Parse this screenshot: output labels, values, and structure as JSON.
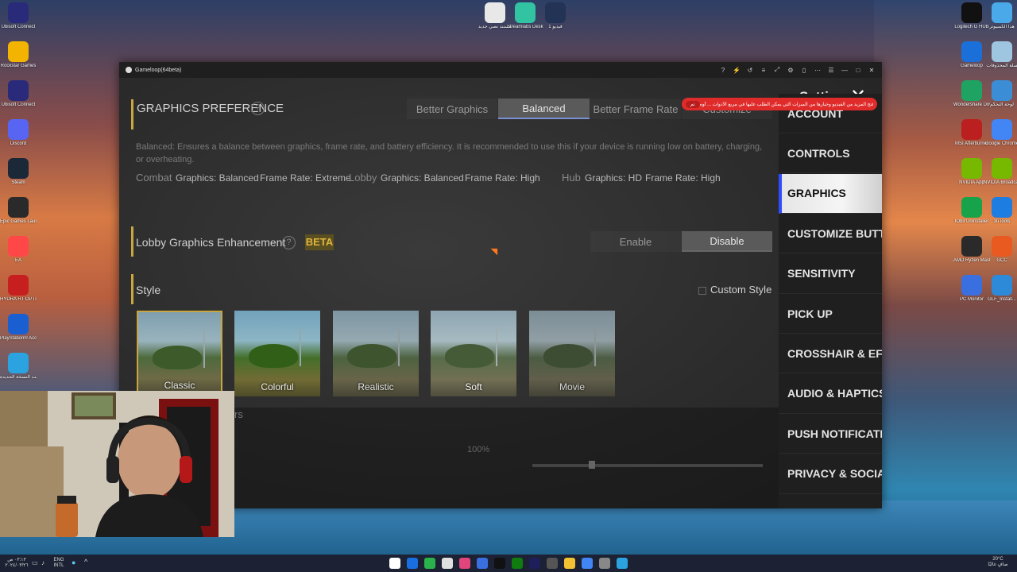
{
  "desktop": {
    "left_icons": [
      {
        "label": "Ubisoft Connect",
        "icon": "ubisoft-icon",
        "color": "#2a2a7a"
      },
      {
        "label": "Rockstar Games",
        "icon": "rockstar-icon",
        "color": "#f2b400"
      },
      {
        "label": "Ubisoft Connect",
        "icon": "ubisoft-icon",
        "color": "#2a2a7a"
      },
      {
        "label": "Discord",
        "icon": "discord-icon",
        "color": "#5865f2"
      },
      {
        "label": "Steam",
        "icon": "steam-icon",
        "color": "#1b2838"
      },
      {
        "label": "Epic Games Launcher",
        "icon": "epic-icon",
        "color": "#2a2a2a"
      },
      {
        "label": "EA",
        "icon": "ea-icon",
        "color": "#ff4747"
      },
      {
        "label": "HYDRA RT OPTICAL",
        "icon": "hydra-icon",
        "color": "#c71f1f"
      },
      {
        "label": "PlayStation® Accessories",
        "icon": "playstation-icon",
        "color": "#1a5fd1"
      },
      {
        "label": "تحديث النسخة الجديدة",
        "icon": "update-icon",
        "color": "#2aa3e0"
      }
    ],
    "top_icons": [
      {
        "label": "مستند نصي جديد",
        "icon": "document-icon",
        "color": "#e8e8e8"
      },
      {
        "label": "Streamlabs Desktop",
        "icon": "streamlabs-icon",
        "color": "#31c3a2"
      },
      {
        "label": "فيديو 1",
        "icon": "video-icon",
        "color": "#223355"
      }
    ],
    "right_icons": [
      {
        "label": "Logitech G HUB",
        "icon": "logitech-icon",
        "color": "#111111"
      },
      {
        "label": "هذا الكمبيوتر",
        "icon": "computer-icon",
        "color": "#4aa9e8"
      },
      {
        "label": "Gameloop",
        "icon": "gameloop-icon",
        "color": "#1b6fd9"
      },
      {
        "label": "سلة المحذوفات",
        "icon": "recycle-bin-icon",
        "color": "#9fc6e0"
      },
      {
        "label": "Wondershare Downloader",
        "icon": "wondershare-icon",
        "color": "#1ea363"
      },
      {
        "label": "لوحة التحكم",
        "icon": "control-panel-icon",
        "color": "#3b8ed6"
      },
      {
        "label": "MSI Afterburner",
        "icon": "afterburner-icon",
        "color": "#bb1f1f"
      },
      {
        "label": "Google Chrome",
        "icon": "chrome-icon",
        "color": "#4285f4"
      },
      {
        "label": "NVIDIA App",
        "icon": "nvidia-icon",
        "color": "#76b900"
      },
      {
        "label": "NVIDIA Broadcast",
        "icon": "nvidia-broadcast-icon",
        "color": "#76b900"
      },
      {
        "label": "IObit Uninstaller",
        "icon": "iobit-icon",
        "color": "#17a34a"
      },
      {
        "label": "3uTools",
        "icon": "3utools-icon",
        "color": "#1e7de0"
      },
      {
        "label": "AMD Ryzen Master",
        "icon": "ryzen-icon",
        "color": "#2a2a2a"
      },
      {
        "label": "GCC",
        "icon": "gcc-icon",
        "color": "#e85a1f"
      },
      {
        "label": "PC Monitor",
        "icon": "pc-monitor-icon",
        "color": "#3a6fe0"
      },
      {
        "label": "GLF_Install...",
        "icon": "installer-icon",
        "color": "#2c8ad9"
      }
    ]
  },
  "window": {
    "title": "Gameloop(64beta)",
    "controls": [
      "?",
      "⚡",
      "↺",
      "≡",
      "⤢",
      "⚙",
      "▯",
      "⋯",
      "☰",
      "—",
      "□",
      "✕"
    ]
  },
  "banner": {
    "message": "افتح المزيد من الفيديو وخيارها من الميزات التي يمكن الطلب عليها في مربع الأدوات ... أوه",
    "button": "تم"
  },
  "settings": {
    "title": "Settings",
    "close": "✕",
    "nav": [
      {
        "label": "ACCOUNT",
        "active": false
      },
      {
        "label": "CONTROLS",
        "active": false
      },
      {
        "label": "GRAPHICS",
        "active": true
      },
      {
        "label": "CUSTOMIZE BUTTONS",
        "active": false
      },
      {
        "label": "SENSITIVITY",
        "active": false
      },
      {
        "label": "PICK UP",
        "active": false
      },
      {
        "label": "CROSSHAIR & EFFECTS",
        "active": false
      },
      {
        "label": "AUDIO & HAPTICS",
        "active": false
      },
      {
        "label": "PUSH NOTIFICATIONS",
        "active": false
      },
      {
        "label": "PRIVACY & SOCIAL",
        "active": false
      }
    ]
  },
  "graphics": {
    "preference_label": "GRAPHICS PREFERENCE",
    "preference_options": [
      "Better Graphics",
      "Balanced",
      "Better Frame Rate",
      "Customize"
    ],
    "preference_selected": "Balanced",
    "description": "Balanced: Ensures a balance between graphics, frame rate, and battery efficiency. It is recommended to use this if your device is running low on battery, charging, or overheating.",
    "modes": [
      {
        "mode": "Combat",
        "graphics": "Graphics: Balanced",
        "frame_rate": "Frame Rate: Extreme"
      },
      {
        "mode": "Lobby",
        "graphics": "Graphics: Balanced",
        "frame_rate": "Frame Rate: High"
      },
      {
        "mode": "Hub",
        "graphics": "Graphics: HD",
        "frame_rate": "Frame Rate: High"
      }
    ],
    "lobby_enhancement_label": "Lobby Graphics Enhancement",
    "beta": "BETA",
    "enable": "Enable",
    "disable": "Disable",
    "style_label": "Style",
    "custom_style": "Custom Style",
    "styles": [
      "Classic",
      "Colorful",
      "Realistic",
      "Soft",
      "Movie"
    ],
    "style_selected": "Classic",
    "partial_label": "rs",
    "partial_value": "100%"
  },
  "taskbar": {
    "lang": "ENG",
    "lang2": "INTL",
    "weather": "20°C",
    "weather_sub": "صافٍ غالبًا",
    "time": "٠٣:١٣ ص",
    "date": "٢٠٢٤/٠٣/٢٦"
  }
}
